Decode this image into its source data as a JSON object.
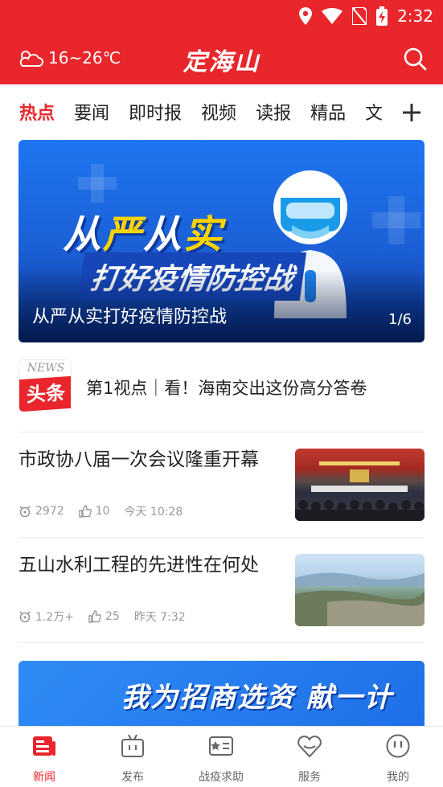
{
  "status_bar": {
    "time": "2:32"
  },
  "header": {
    "temperature": "16~26℃",
    "app_title": "定海山",
    "colors": {
      "brand": "#e8262c"
    }
  },
  "tabs": [
    {
      "label": "热点",
      "active": true
    },
    {
      "label": "要闻"
    },
    {
      "label": "即时报"
    },
    {
      "label": "视频"
    },
    {
      "label": "读报"
    },
    {
      "label": "精品"
    },
    {
      "label": "文"
    }
  ],
  "banner": {
    "headline_part1": "从",
    "headline_part2": "严",
    "headline_part3": "从",
    "headline_part4": "实",
    "headline_line2": "打好疫情防控战",
    "caption": "从严从实打好疫情防控战",
    "counter": "1/6"
  },
  "headline": {
    "badge_top": "NEWS",
    "badge_main": "头条",
    "text": "第1视点｜看！海南交出这份高分答卷"
  },
  "news": [
    {
      "title": "市政协八届一次会议隆重开幕",
      "views": "2972",
      "likes": "10",
      "time": "今天 10:28"
    },
    {
      "title": "五山水利工程的先进性在何处",
      "views": "1.2万+",
      "likes": "25",
      "time": "昨天 7:32"
    }
  ],
  "promo": {
    "text": "我为招商选资 献一计"
  },
  "bottom_nav": [
    {
      "label": "新闻",
      "icon": "news-icon",
      "active": true
    },
    {
      "label": "发布",
      "icon": "tv-icon"
    },
    {
      "label": "战疫求助",
      "icon": "help-card-icon"
    },
    {
      "label": "服务",
      "icon": "service-heart-icon"
    },
    {
      "label": "我的",
      "icon": "profile-face-icon"
    }
  ]
}
